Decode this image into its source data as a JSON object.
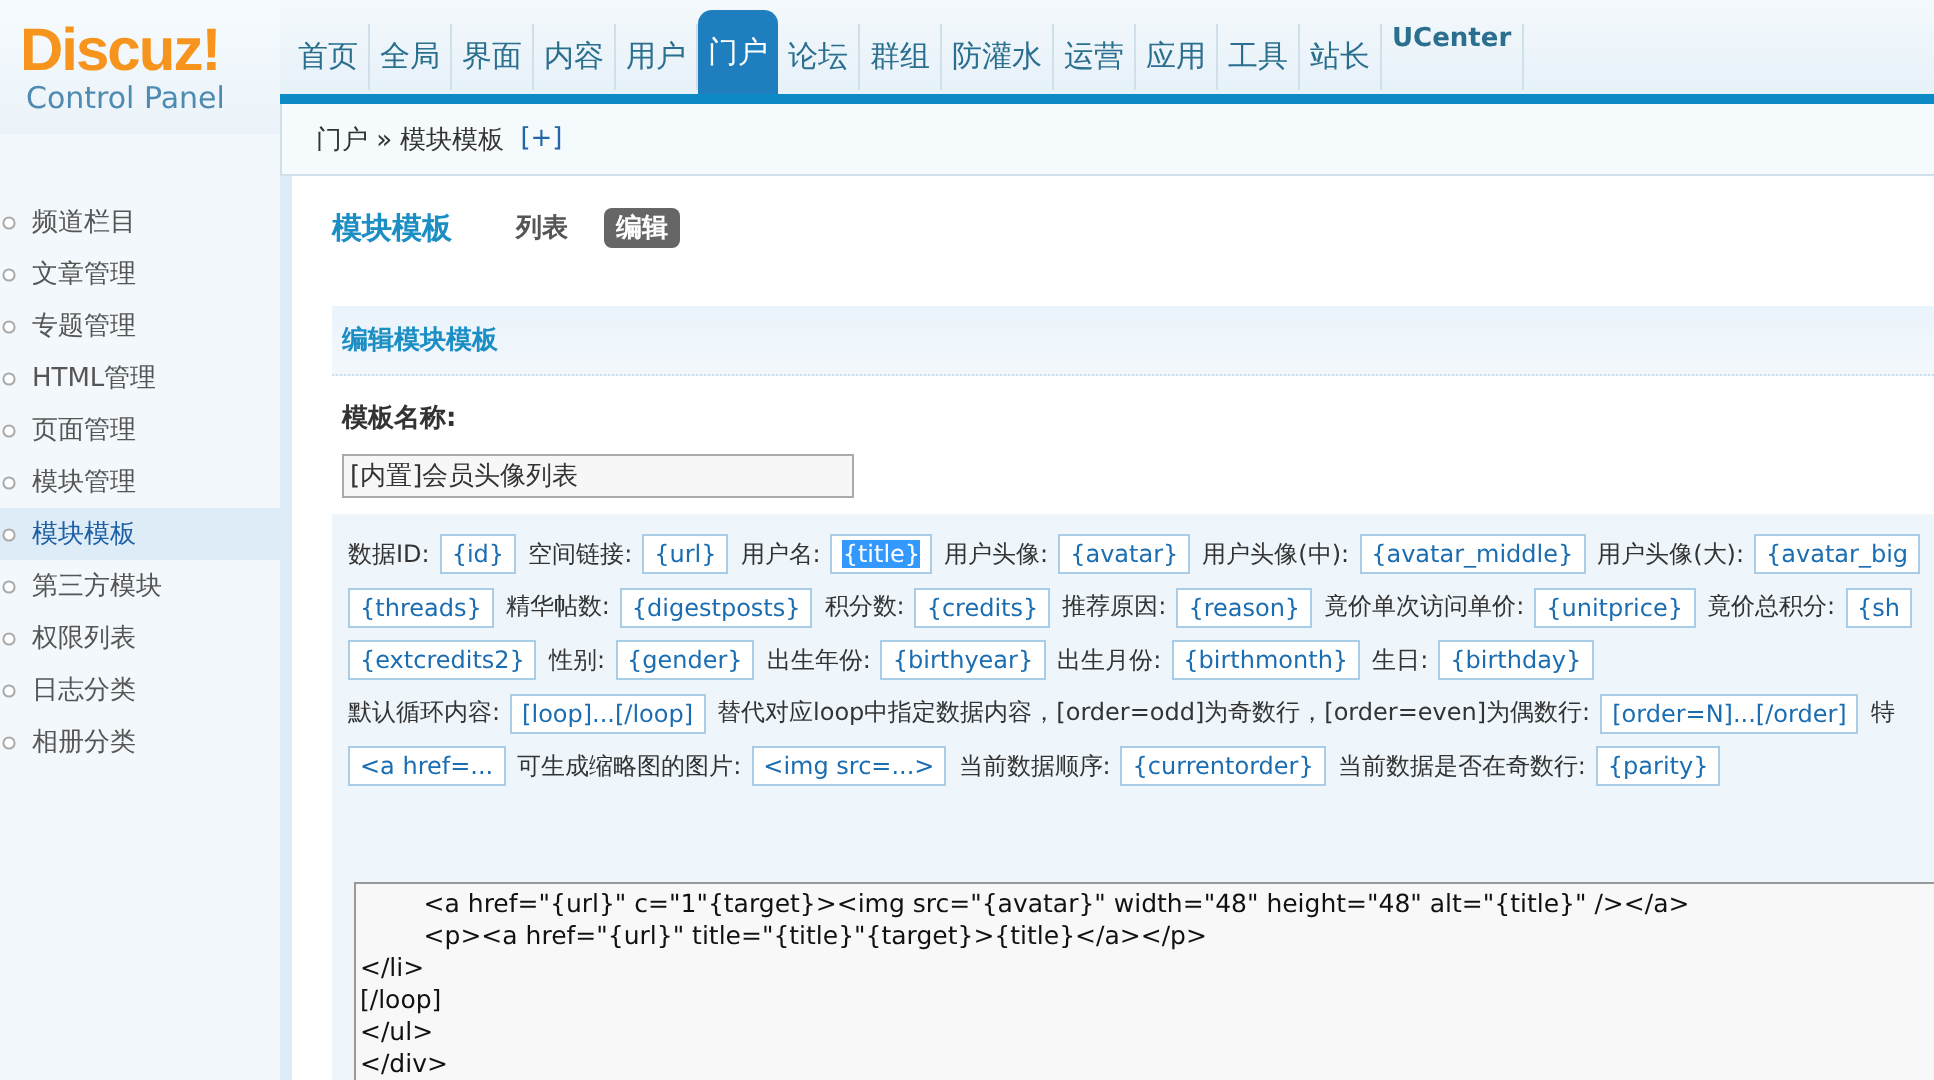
{
  "logo": {
    "title": "Discuz!",
    "subtitle": "Control Panel"
  },
  "nav": [
    {
      "label": "首页",
      "selected": false
    },
    {
      "label": "全局",
      "selected": false
    },
    {
      "label": "界面",
      "selected": false
    },
    {
      "label": "内容",
      "selected": false
    },
    {
      "label": "用户",
      "selected": false
    },
    {
      "label": "门户",
      "selected": true
    },
    {
      "label": "论坛",
      "selected": false
    },
    {
      "label": "群组",
      "selected": false
    },
    {
      "label": "防灌水",
      "selected": false
    },
    {
      "label": "运营",
      "selected": false
    },
    {
      "label": "应用",
      "selected": false
    },
    {
      "label": "工具",
      "selected": false
    },
    {
      "label": "站长",
      "selected": false
    },
    {
      "label": "UCenter",
      "selected": false
    }
  ],
  "breadcrumb": {
    "path": "门户 » 模块模板",
    "add": "[+]"
  },
  "sidebar": {
    "items": [
      {
        "label": "频道栏目",
        "selected": false
      },
      {
        "label": "文章管理",
        "selected": false
      },
      {
        "label": "专题管理",
        "selected": false
      },
      {
        "label": "HTML管理",
        "selected": false
      },
      {
        "label": "页面管理",
        "selected": false
      },
      {
        "label": "模块管理",
        "selected": false
      },
      {
        "label": "模块模板",
        "selected": true
      },
      {
        "label": "第三方模块",
        "selected": false
      },
      {
        "label": "权限列表",
        "selected": false
      },
      {
        "label": "日志分类",
        "selected": false
      },
      {
        "label": "相册分类",
        "selected": false
      }
    ]
  },
  "page": {
    "title": "模块模板",
    "tabs": [
      {
        "label": "列表",
        "selected": false
      },
      {
        "label": "编辑",
        "selected": true
      }
    ]
  },
  "section": {
    "title": "编辑模块模板",
    "field_label": "模板名称:",
    "field_value": "[内置]会员头像列表"
  },
  "variables": [
    [
      {
        "label": "数据ID:",
        "tag": "{id}",
        "selected": false
      },
      {
        "label": "空间链接:",
        "tag": "{url}",
        "selected": false
      },
      {
        "label": "用户名:",
        "tag": "{title}",
        "selected": true
      },
      {
        "label": "用户头像:",
        "tag": "{avatar}",
        "selected": false
      },
      {
        "label": "用户头像(中):",
        "tag": "{avatar_middle}",
        "selected": false
      },
      {
        "label": "用户头像(大):",
        "tag": "{avatar_big",
        "selected": false
      }
    ],
    [
      {
        "tag": "{threads}",
        "selected": false
      },
      {
        "label": "精华帖数:",
        "tag": "{digestposts}",
        "selected": false
      },
      {
        "label": "积分数:",
        "tag": "{credits}",
        "selected": false
      },
      {
        "label": "推荐原因:",
        "tag": "{reason}",
        "selected": false
      },
      {
        "label": "竟价单次访问单价:",
        "tag": "{unitprice}",
        "selected": false
      },
      {
        "label": "竟价总积分:",
        "tag": "{sh",
        "selected": false
      }
    ],
    [
      {
        "tag": "{extcredits2}",
        "selected": false
      },
      {
        "label": "性别:",
        "tag": "{gender}",
        "selected": false
      },
      {
        "label": "出生年份:",
        "tag": "{birthyear}",
        "selected": false
      },
      {
        "label": "出生月份:",
        "tag": "{birthmonth}",
        "selected": false
      },
      {
        "label": "生日:",
        "tag": "{birthday}",
        "selected": false
      }
    ],
    [
      {
        "label": "默认循环内容:",
        "tag": "[loop]...[/loop]",
        "selected": false
      },
      {
        "label": "替代对应loop中指定数据内容，[order=odd]为奇数行，[order=even]为偶数行:",
        "tag": "[order=N]...[/order]",
        "selected": false
      },
      {
        "label": "特"
      }
    ],
    [
      {
        "tag": "<a href=...",
        "selected": false
      },
      {
        "label": "可生成缩略图的图片:",
        "tag": "<img src=...>",
        "selected": false
      },
      {
        "label": "当前数据顺序:",
        "tag": "{currentorder}",
        "selected": false
      },
      {
        "label": "当前数据是否在奇数行:",
        "tag": "{parity}",
        "selected": false
      }
    ]
  ],
  "code": "        <a href=\"{url}\" c=\"1\"{target}><img src=\"{avatar}\" width=\"48\" height=\"48\" alt=\"{title}\" /></a>\n        <p><a href=\"{url}\" title=\"{title}\"{target}>{title}</a></p>\n</li>\n[/loop]\n</ul>\n</div>"
}
